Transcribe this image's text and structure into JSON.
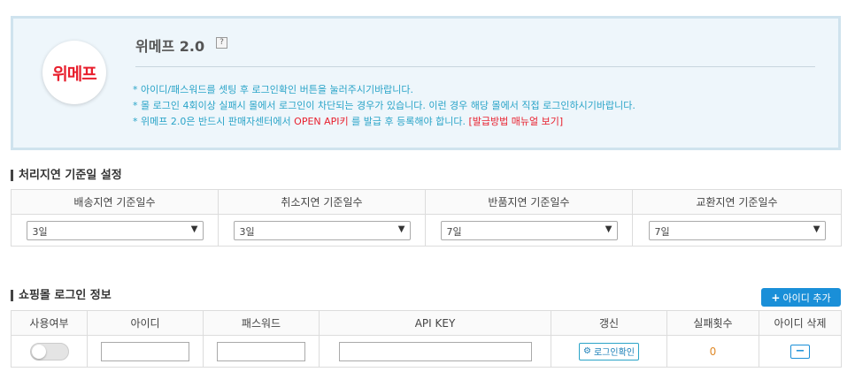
{
  "mall": {
    "logo_text": "위메프",
    "title": "위메프 2.0",
    "help_symbol": "?",
    "notes": [
      "* 아이디/패스워드를 셋팅 후 로그인확인 버튼을 눌러주시기바랍니다.",
      "* 몰 로그인 4회이상 실패시 몰에서 로그인이 차단되는 경우가 있습니다. 이런 경우 해당 몰에서 직접 로그인하시기바랍니다."
    ],
    "note3": {
      "prefix": "* 위메프 2.0은 반드시 판매자센터에서 ",
      "highlight": "OPEN API키",
      "middle": " 를 발급 후 등록해야 합니다. ",
      "link": "[발급방법 매뉴얼 보기]"
    }
  },
  "delay_settings": {
    "title": "처리지연 기준일 설정",
    "columns": [
      {
        "label": "배송지연 기준일수",
        "value": "3일"
      },
      {
        "label": "취소지연 기준일수",
        "value": "3일"
      },
      {
        "label": "반품지연 기준일수",
        "value": "7일"
      },
      {
        "label": "교환지연 기준일수",
        "value": "7일"
      }
    ]
  },
  "login_info": {
    "title": "쇼핑몰 로그인 정보",
    "add_button": "아이디 추가",
    "headers": [
      "사용여부",
      "아이디",
      "패스워드",
      "API KEY",
      "갱신",
      "실패횟수",
      "아이디 삭제"
    ],
    "row": {
      "login_check_label": "로그인확인",
      "fail_count": "0",
      "delete_symbol": "−"
    }
  },
  "colors": {
    "accent": "#1a8fd8",
    "note_text": "#2aa4c8",
    "brand_red": "#e8202e",
    "info_bg": "#eef6fb"
  }
}
